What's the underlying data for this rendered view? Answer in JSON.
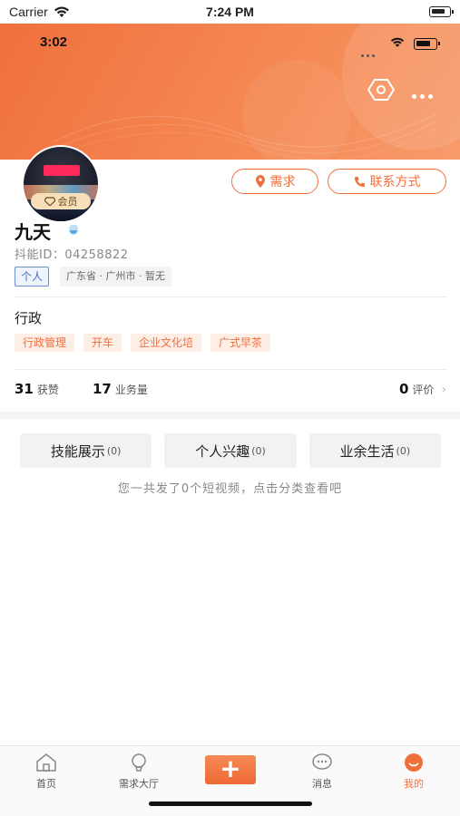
{
  "status_bar": {
    "carrier": "Carrier",
    "time": "7:24 PM"
  },
  "inner_status": {
    "time": "3:02"
  },
  "profile": {
    "member_badge": "会员",
    "name": "九天",
    "douyin_id": "抖能ID：04258822",
    "tag_type": "个人",
    "location": "广东省 · 广州市 · 暂无"
  },
  "actions": {
    "need_label": "需求",
    "contact_label": "联系方式"
  },
  "job": {
    "title": "行政",
    "skills": [
      "行政管理",
      "开车",
      "企业文化培",
      "广式早茶"
    ]
  },
  "stats": {
    "likes_count": "31",
    "likes_label": "获赞",
    "business_count": "17",
    "business_label": "业务量",
    "review_count": "0",
    "review_label": "评价"
  },
  "categories": [
    {
      "label": "技能展示",
      "count": "(0)"
    },
    {
      "label": "个人兴趣",
      "count": "(0)"
    },
    {
      "label": "业余生活",
      "count": "(0)"
    }
  ],
  "hint": "您一共发了0个短视频，点击分类查看吧",
  "tabbar": {
    "home": "首页",
    "hall": "需求大厅",
    "add": "+",
    "messages": "消息",
    "mine": "我的"
  },
  "colors": {
    "accent": "#f0703c",
    "tag_blue": "#4a6fc4"
  },
  "icons": [
    "wifi-icon",
    "battery-icon",
    "settings-hex-icon",
    "more-dots-icon",
    "diamond-icon",
    "pin-icon",
    "phone-icon",
    "verified-icon",
    "chevron-right-icon",
    "home-icon",
    "bulb-icon",
    "chat-icon",
    "smile-icon"
  ]
}
